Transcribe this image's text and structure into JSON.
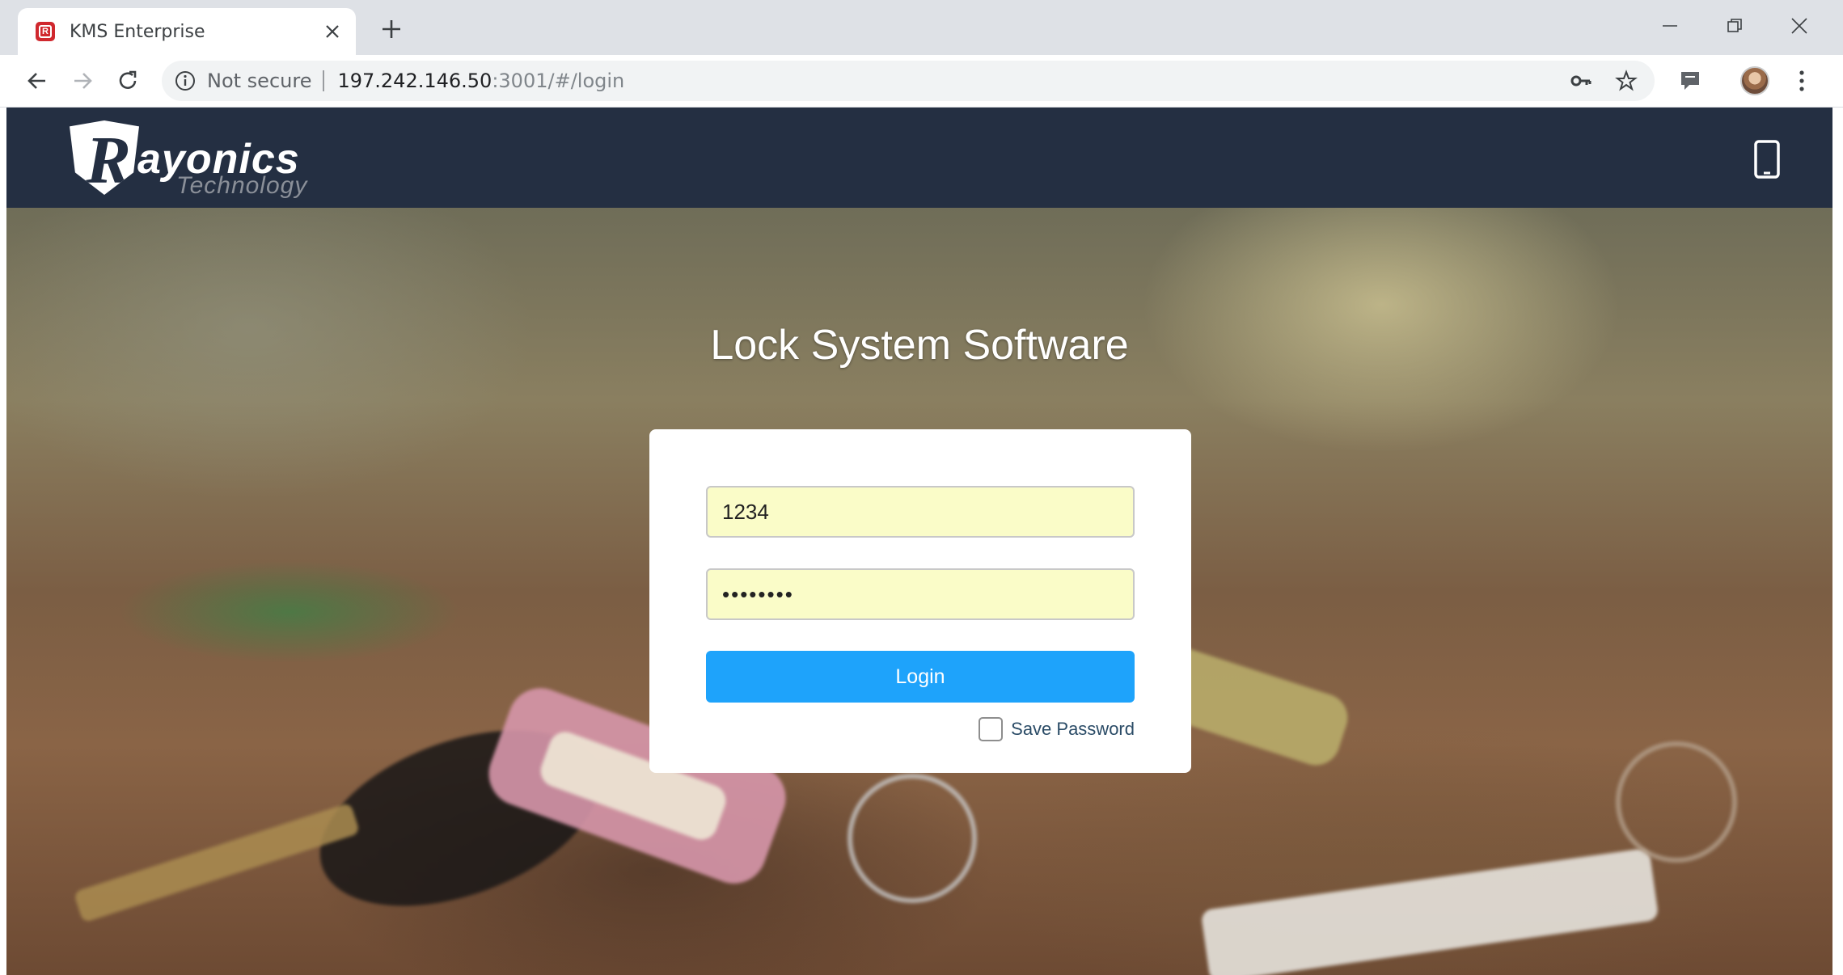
{
  "browser": {
    "tab_title": "KMS Enterprise",
    "favicon_letter": "R",
    "security_label": "Not secure",
    "url_host": "197.242.146.50",
    "url_rest": ":3001/#/login"
  },
  "navbar": {
    "brand": "Rayonics",
    "brand_initial": "R",
    "brand_rest": "ayonics",
    "brand_sub": "Technology",
    "mobile_icon": "phone-icon"
  },
  "page": {
    "title": "Lock System Software"
  },
  "login_form": {
    "username_value": "1234",
    "password_value": "••••••••",
    "login_label": "Login",
    "save_password_label": "Save Password",
    "save_password_checked": false
  },
  "colors": {
    "navbar_bg": "#242f42",
    "login_button": "#1ea3fb",
    "autofill_bg": "#fafcc8"
  }
}
